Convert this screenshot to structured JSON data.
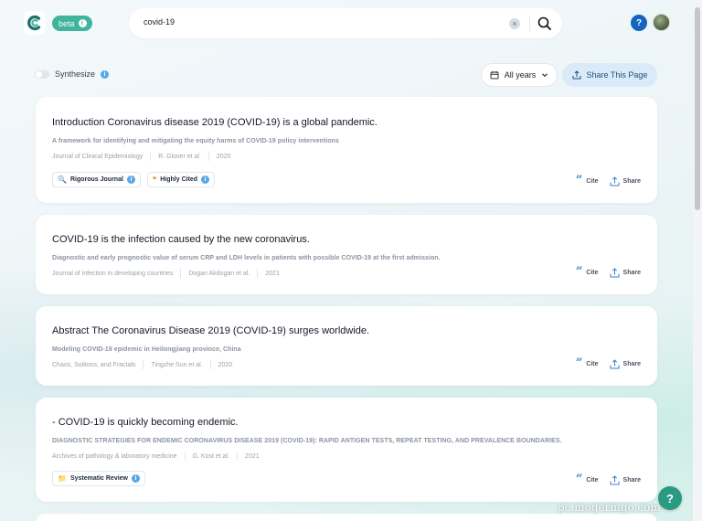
{
  "header": {
    "beta_label": "beta",
    "beta_info": "i",
    "search_value": "covid-19",
    "clear_glyph": "×",
    "help_glyph": "?"
  },
  "controls": {
    "synthesize_label": "Synthesize",
    "info_glyph": "i",
    "years_label": "All years",
    "share_page_label": "Share This Page"
  },
  "icons": [
    "logo-icon",
    "search-icon",
    "clear-icon",
    "help-icon",
    "calendar-icon",
    "chevron-down-icon",
    "share-icon",
    "quote-icon",
    "chat-icon"
  ],
  "colors": {
    "brand": "#3fb59d",
    "accent_blue": "#3b82c4",
    "help_blue": "#1565c0",
    "share_page_bg": "#dbeaf8"
  },
  "results": [
    {
      "title": "Introduction Coronavirus disease 2019 (COVID-19) is a global pandemic.",
      "paper": "A framework for identifying and mitigating the equity harms of COVID-19 policy interventions",
      "journal": "Journal of Clinical Epidemiology",
      "authors": "R. Glover et al.",
      "year": "2020",
      "badges": [
        {
          "icon": "🔍",
          "label": "Rigorous Journal"
        },
        {
          "icon": "❝",
          "label": "Highly Cited"
        }
      ],
      "cite_label": "Cite",
      "share_label": "Share"
    },
    {
      "title": "COVID-19 is the infection caused by the new coronavirus.",
      "paper": "Diagnostic and early prognostic value of serum CRP and LDH levels in patients with possible COVID-19 at the first admission.",
      "journal": "Journal of infection in developing countries",
      "authors": "Dogan Akdogan et al.",
      "year": "2021",
      "badges": [],
      "cite_label": "Cite",
      "share_label": "Share"
    },
    {
      "title": "Abstract The Coronavirus Disease 2019 (COVID-19) surges worldwide.",
      "paper": "Modeling COVID-19 epidemic in Heilongjiang province, China",
      "journal": "Chaos, Solitons, and Fractals",
      "authors": "Tingzhe Sun et al.",
      "year": "2020",
      "badges": [],
      "cite_label": "Cite",
      "share_label": "Share"
    },
    {
      "title": "- COVID-19 is quickly becoming endemic.",
      "paper": "DIAGNOSTIC STRATEGIES FOR ENDEMIC CORONAVIRUS DISEASE 2019 (COVID-19): RAPID ANTIGEN TESTS, REPEAT TESTING, AND PREVALENCE BOUNDARIES.",
      "journal": "Archives of pathology & laboratory medicine",
      "authors": "G. Kost et al.",
      "year": "2021",
      "badges": [
        {
          "icon": "📁",
          "label": "Systematic Review"
        }
      ],
      "cite_label": "Cite",
      "share_label": "Share"
    }
  ],
  "chat_glyph": "?",
  "watermark": "pc.mogeringo.com"
}
